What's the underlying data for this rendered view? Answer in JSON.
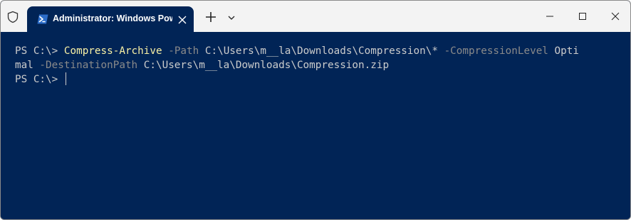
{
  "titlebar": {
    "tab_title": "Administrator: Windows PowerShell"
  },
  "terminal": {
    "prompt": "PS C:\\> ",
    "line1_cmd": "Compress-Archive",
    "line1_p1": " -Path",
    "line1_a1": " C:\\Users\\m__la\\Downloads\\Compression\\*",
    "line1_p2": " -CompressionLevel",
    "line1_a2": " Opti",
    "line2_a2": "mal",
    "line2_p3": " -DestinationPath",
    "line2_a3": " C:\\Users\\m__la\\Downloads\\Compression.zip",
    "prompt2": "PS C:\\> "
  },
  "icons": [
    "shield-icon",
    "powershell-icon",
    "close-tab-icon",
    "plus-icon",
    "chevron-down-icon",
    "minimize-icon",
    "maximize-icon",
    "close-icon"
  ],
  "colors": {
    "terminal_bg": "#012456",
    "command": "#f9f1a5",
    "parameter": "#8a8a8a",
    "text": "#cccccc",
    "titlebar_bg": "#f3f3f3"
  }
}
